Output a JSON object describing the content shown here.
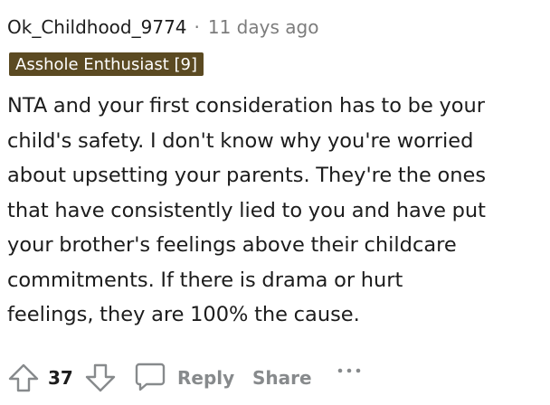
{
  "comment": {
    "author": "Ok_Childhood_9774",
    "separator": "·",
    "time_ago": "11 days ago",
    "flair": "Asshole Enthusiast [9]",
    "lines": [
      "NTA and your first consideration has to be your",
      "child's safety. I don't know why you're worried",
      "about upsetting your parents. They're the ones",
      "that have consistently lied to you and have put",
      "your brother's feelings above their childcare",
      "commitments. If there is drama or hurt",
      "feelings, they are 100% the cause."
    ]
  },
  "actions": {
    "upvote_icon": "arrow-up-outline-icon",
    "score": "37",
    "downvote_icon": "arrow-down-outline-icon",
    "reply_icon": "speech-bubble-icon",
    "reply_label": "Reply",
    "share_label": "Share",
    "more_icon": "ellipsis-icon"
  },
  "colors": {
    "text": "#1c1c1c",
    "muted": "#7c7c7c",
    "action_gray": "#878a8c",
    "flair_bg": "#5b4a22",
    "flair_text": "#ffffff"
  }
}
